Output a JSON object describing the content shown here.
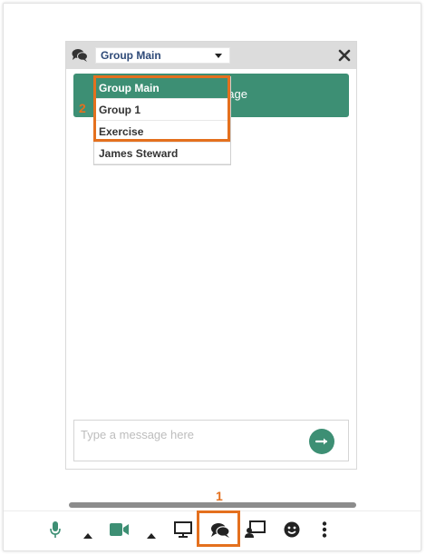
{
  "chat": {
    "selected_group": "Group Main",
    "welcome_text": "essage",
    "dropdown_options": [
      "Group Main",
      "Group 1",
      "Exercise",
      "James Steward"
    ],
    "input_placeholder": "Type a message here"
  },
  "callouts": {
    "one": "1",
    "two": "2"
  },
  "colors": {
    "accent": "#3d8f74",
    "highlight": "#e4701e",
    "select_text": "#2e4a78"
  },
  "toolbar": {
    "icons": [
      "microphone-icon",
      "caret-up-icon",
      "camera-icon",
      "caret-up-icon",
      "monitor-icon",
      "chat-icon",
      "screen-share-icon",
      "smile-icon",
      "more-vertical-icon"
    ]
  }
}
